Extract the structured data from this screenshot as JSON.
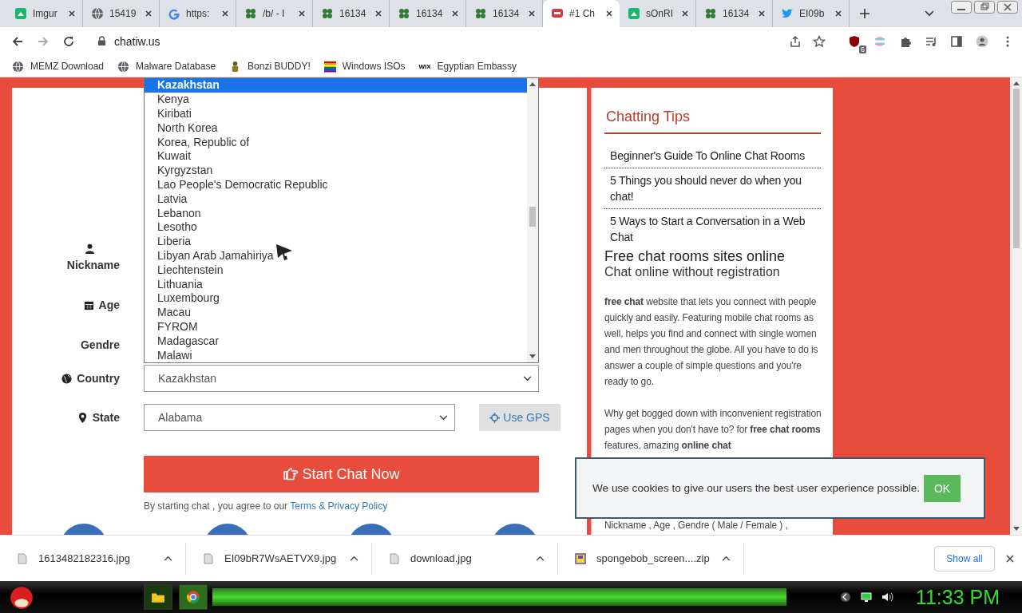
{
  "tabs": [
    {
      "title": "Imgur",
      "kind": "imgur",
      "selected": false
    },
    {
      "title": "15419",
      "kind": "globe",
      "selected": false
    },
    {
      "title": "https:",
      "kind": "google",
      "selected": false
    },
    {
      "title": "/b/ - I",
      "kind": "clover",
      "selected": false
    },
    {
      "title": "16134",
      "kind": "clover",
      "selected": false
    },
    {
      "title": "16134",
      "kind": "clover",
      "selected": false
    },
    {
      "title": "16134",
      "kind": "clover",
      "selected": false
    },
    {
      "title": "#1 Ch",
      "kind": "chatiw",
      "selected": true
    },
    {
      "title": "sOnRI",
      "kind": "imgur",
      "selected": false
    },
    {
      "title": "16134",
      "kind": "clover",
      "selected": false
    },
    {
      "title": "EI09b",
      "kind": "twitter",
      "selected": false
    }
  ],
  "address": "chatiw.us",
  "extension_badge": "6",
  "bookmarks": [
    {
      "label": "MEMZ Download",
      "kind": "globe"
    },
    {
      "label": "Malware Database",
      "kind": "globe"
    },
    {
      "label": "Bonzi BUDDY!",
      "kind": "figure"
    },
    {
      "label": "Windows ISOs",
      "kind": "rainbow"
    },
    {
      "label": "Egyptian Embassy",
      "kind": "wix",
      "icon_text": "WIX"
    }
  ],
  "country_list": [
    {
      "label": "Kazakhstan",
      "selected": true
    },
    {
      "label": "Kenya",
      "selected": false
    },
    {
      "label": "Kiribati",
      "selected": false
    },
    {
      "label": "North Korea",
      "selected": false
    },
    {
      "label": "Korea, Republic of",
      "selected": false
    },
    {
      "label": "Kuwait",
      "selected": false
    },
    {
      "label": "Kyrgyzstan",
      "selected": false
    },
    {
      "label": "Lao People's Democratic Republic",
      "selected": false
    },
    {
      "label": "Latvia",
      "selected": false
    },
    {
      "label": "Lebanon",
      "selected": false
    },
    {
      "label": "Lesotho",
      "selected": false
    },
    {
      "label": "Liberia",
      "selected": false
    },
    {
      "label": "Libyan Arab Jamahiriya",
      "selected": false
    },
    {
      "label": "Liechtenstein",
      "selected": false
    },
    {
      "label": "Lithuania",
      "selected": false
    },
    {
      "label": "Luxembourg",
      "selected": false
    },
    {
      "label": "Macau",
      "selected": false
    },
    {
      "label": "FYROM",
      "selected": false
    },
    {
      "label": "Madagascar",
      "selected": false
    },
    {
      "label": "Malawi",
      "selected": false
    }
  ],
  "form": {
    "labels": [
      {
        "text": "Nickname",
        "kind": "user"
      },
      {
        "text": "Age",
        "kind": "calendar"
      },
      {
        "text": "Gendre",
        "kind": "none"
      },
      {
        "text": "Country",
        "kind": "globe"
      },
      {
        "text": "State",
        "kind": "pin"
      }
    ],
    "country": "Kazakhstan",
    "state": "Alabama",
    "gps_button": "Use GPS",
    "start_button": "Start Chat Now",
    "agreement": "By starting chat , you agree to our",
    "agreement_link": "Terms & Privacy Policy"
  },
  "sidebar": {
    "title": "Chatting Tips",
    "links": [
      "Beginner's Guide To Online Chat Rooms",
      "5 Things you should never do when you chat!",
      "5 Ways to Start a Conversation in a Web Chat"
    ],
    "heading": "Free chat rooms sites online",
    "subheading": "Chat online without registration",
    "paragraphs": [
      "**free chat** website that lets you connect with people quickly and easily. Featuring mobile chat rooms as well, helps you find and connect with single women and men throughout the globe. All you have to do is answer a couple of simple questions and you're ready to go.",
      "Why get bogged down with inconvenient registration pages when you don't have to? for **free chat rooms** features, amazing **online chat**",
      "Nickname , Age , Gendre ( Male / Female ) ,"
    ]
  },
  "cookie": {
    "text": "We use cookies to give our users the best user experience possible.",
    "button": "OK"
  },
  "downloads": [
    {
      "name": "1613482182316.jpg",
      "kind": "image"
    },
    {
      "name": "EI09bR7WsAETVX9.jpg",
      "kind": "image"
    },
    {
      "name": "download.jpg",
      "kind": "image"
    },
    {
      "name": "spongebob_screen....zip",
      "kind": "zip"
    }
  ],
  "show_all": "Show all",
  "clock": "11:33 PM"
}
